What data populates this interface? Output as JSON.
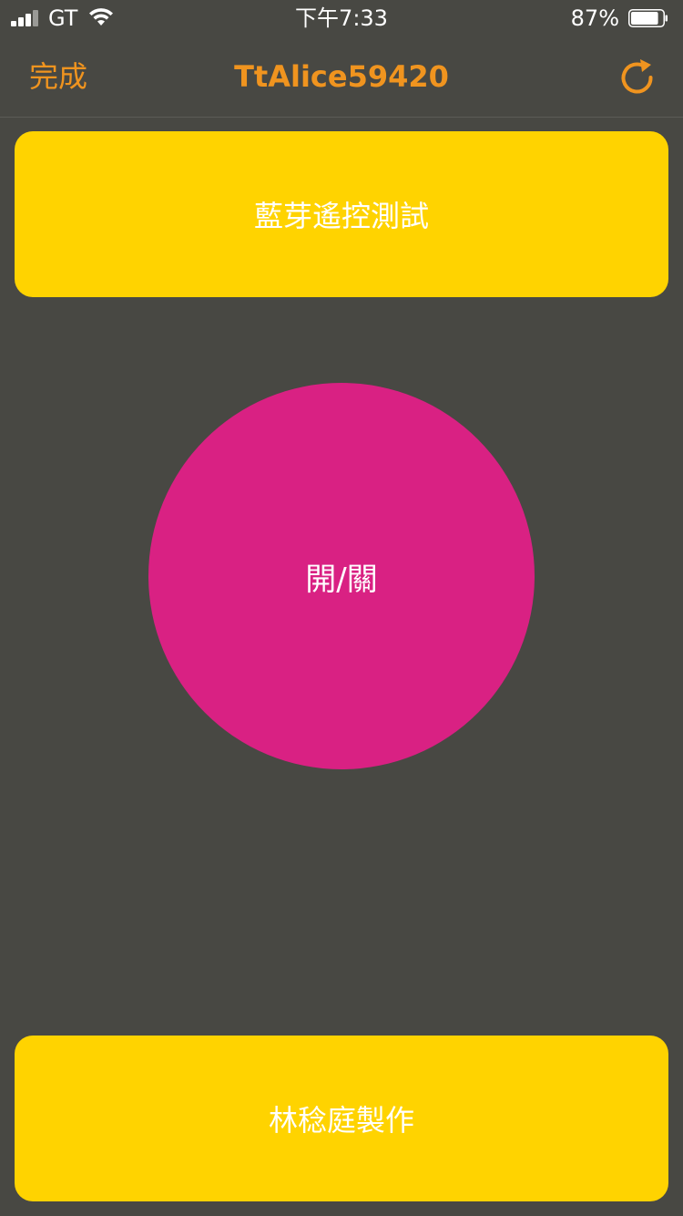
{
  "status_bar": {
    "carrier": "GT",
    "time": "下午7:33",
    "battery_percent": "87%",
    "battery_level": 0.87
  },
  "nav": {
    "done_label": "完成",
    "title": "TtAlice59420",
    "refresh_icon": "refresh-icon"
  },
  "main": {
    "top_button_label": "藍芽遙控測試",
    "power_button_label": "開/關",
    "bottom_button_label": "林稔庭製作"
  },
  "colors": {
    "background": "#484843",
    "accent": "#f0941f",
    "button_yellow": "#ffd300",
    "power_pink": "#d92183"
  }
}
